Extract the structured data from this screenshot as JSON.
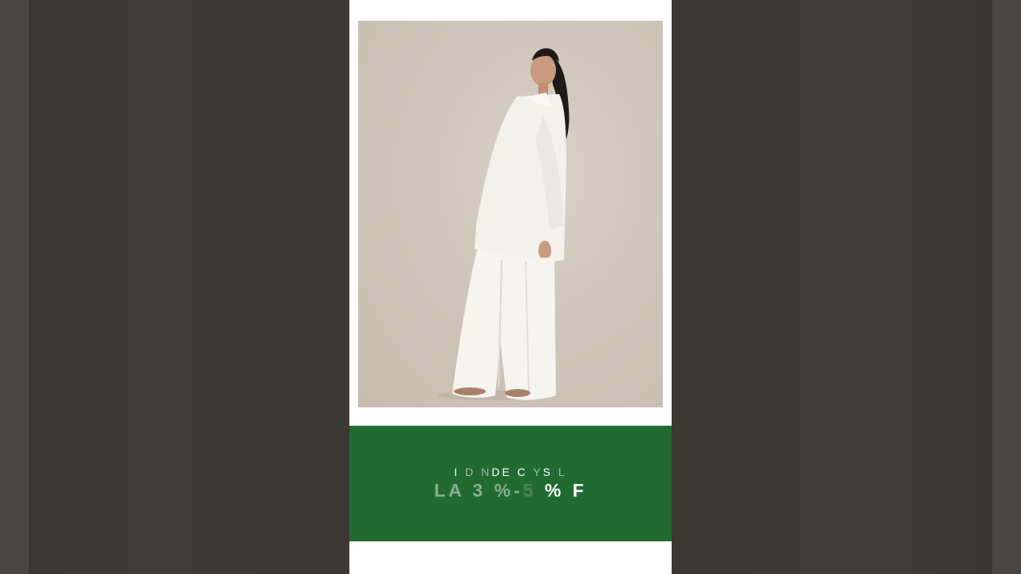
{
  "video": {
    "banner": {
      "line1_parts": [
        {
          "text": "I",
          "style": "normal"
        },
        {
          "text": " D ",
          "style": "fade"
        },
        {
          "text": "N",
          "style": "fade"
        },
        {
          "text": "DE",
          "style": "normal"
        },
        {
          "text": " C ",
          "style": "normal"
        },
        {
          "text": "Y",
          "style": "fade"
        },
        {
          "text": "S",
          "style": "normal"
        },
        {
          "text": " L",
          "style": "fade"
        }
      ],
      "line2_parts": [
        {
          "text": "LA",
          "style": "fade"
        },
        {
          "text": " 3 ",
          "style": "fade"
        },
        {
          "text": "%-",
          "style": "fade"
        },
        {
          "text": "5 ",
          "style": "faint"
        },
        {
          "text": "%",
          "style": "normal"
        },
        {
          "text": " F",
          "style": "normal"
        }
      ]
    },
    "photo_alt": "woman-in-white-shirt-and-wide-leg-trousers"
  },
  "colors": {
    "banner_green": "#216b31",
    "photo_background": "#cfc6b9",
    "outer_background": "#3b3732"
  }
}
